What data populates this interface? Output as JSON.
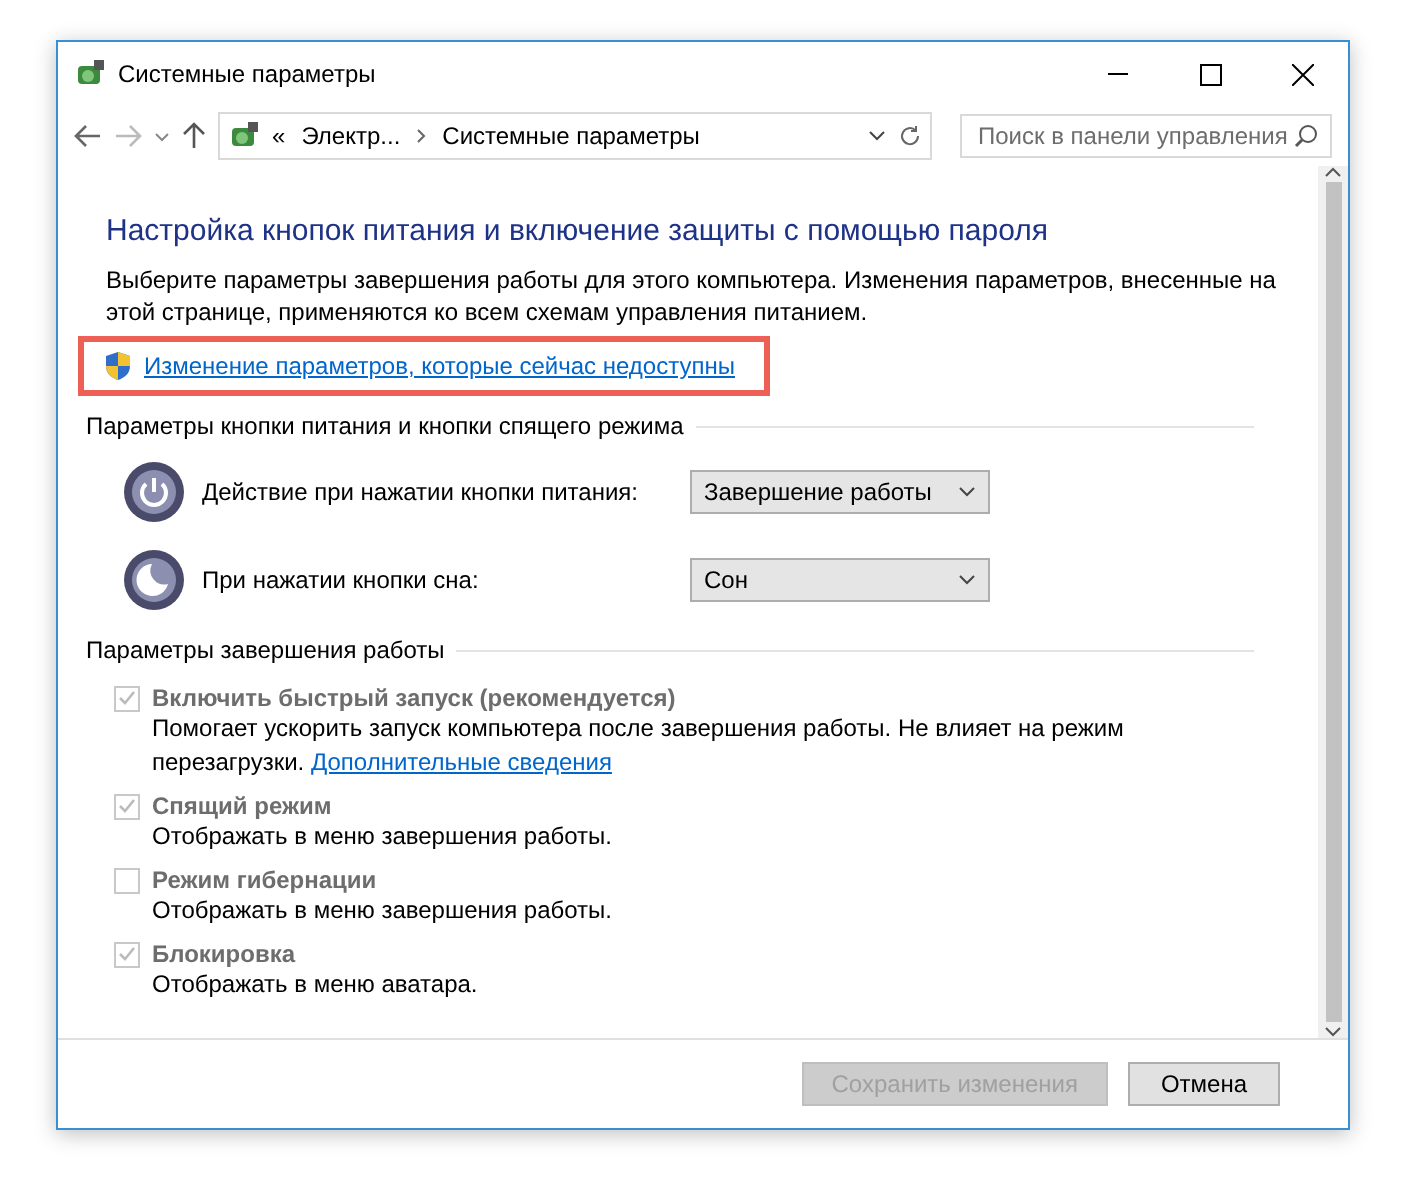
{
  "window": {
    "title": "Системные параметры"
  },
  "address": {
    "overflow": "«",
    "crumbs": [
      "Электр...",
      "Системные параметры"
    ]
  },
  "search": {
    "placeholder": "Поиск в панели управления"
  },
  "heading": "Настройка кнопок питания и включение защиты с помощью пароля",
  "intro": "Выберите параметры завершения работы для этого компьютера. Изменения параметров, внесенные на этой странице, применяются ко всем схемам управления питанием.",
  "admin_link": "Изменение параметров, которые сейчас недоступны",
  "buttons_section": {
    "title": "Параметры кнопки питания и кнопки спящего режима",
    "rows": [
      {
        "kind": "power",
        "label": "Действие при нажатии кнопки питания:",
        "value": "Завершение работы"
      },
      {
        "kind": "sleep",
        "label": "При нажатии кнопки сна:",
        "value": "Сон"
      }
    ]
  },
  "shutdown_section": {
    "title": "Параметры завершения работы",
    "options": [
      {
        "label": "Включить быстрый запуск (рекомендуется)",
        "checked": true,
        "disabled": true,
        "description": "Помогает ускорить запуск компьютера после завершения работы. Не влияет на режим перезагрузки.",
        "link": "Дополнительные сведения"
      },
      {
        "label": "Спящий режим",
        "checked": true,
        "disabled": true,
        "description": "Отображать в меню завершения работы."
      },
      {
        "label": "Режим гибернации",
        "checked": false,
        "disabled": true,
        "description": "Отображать в меню завершения работы."
      },
      {
        "label": "Блокировка",
        "checked": true,
        "disabled": true,
        "description": "Отображать в меню аватара."
      }
    ]
  },
  "footer": {
    "buttons": [
      {
        "label": "Сохранить изменения",
        "disabled": true
      },
      {
        "label": "Отмена",
        "disabled": false
      }
    ]
  }
}
